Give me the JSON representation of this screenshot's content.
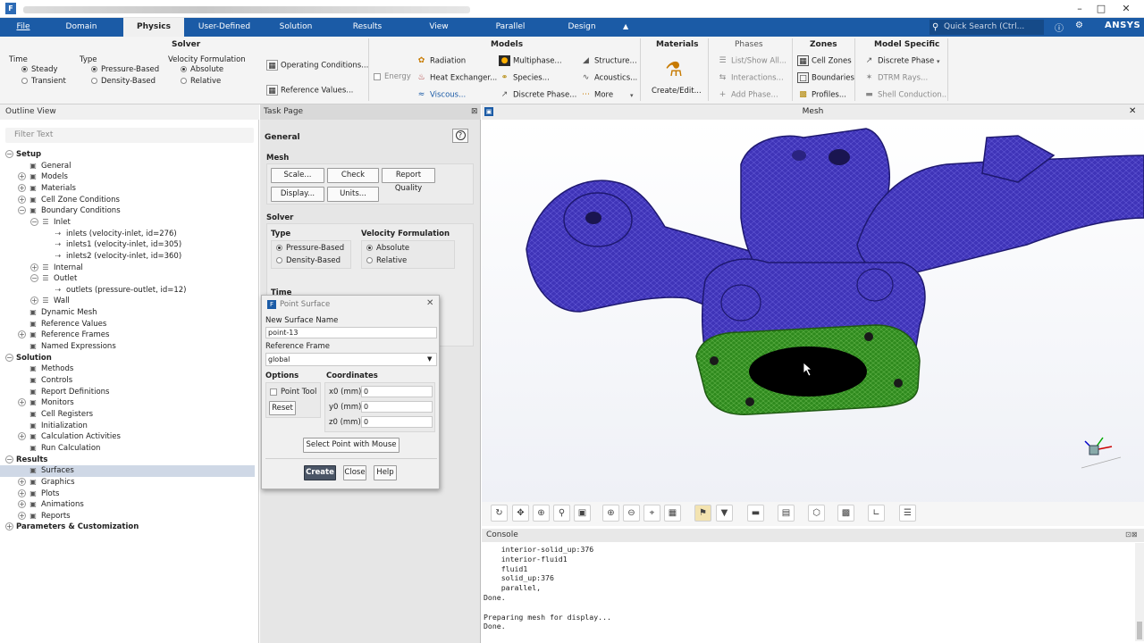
{
  "window": {
    "logo": "F",
    "controls": [
      "–",
      "□",
      "✕"
    ]
  },
  "menu": {
    "items": [
      "File",
      "Domain",
      "Physics",
      "User-Defined",
      "Solution",
      "Results",
      "View",
      "Parallel",
      "Design"
    ],
    "active": "Physics",
    "search_placeholder": "Quick Search (Ctrl...",
    "brand": "ANSYS",
    "caret": "▲"
  },
  "ribbon": {
    "solver": {
      "title": "Solver",
      "time_label": "Time",
      "time_options": [
        "Steady",
        "Transient"
      ],
      "type_label": "Type",
      "type_options": [
        "Pressure-Based",
        "Density-Based"
      ],
      "velocity_label": "Velocity Formulation",
      "velocity_options": [
        "Absolute",
        "Relative"
      ],
      "operating": "Operating Conditions...",
      "reference": "Reference Values..."
    },
    "models": {
      "title": "Models",
      "energy": "Energy",
      "items": [
        "Radiation",
        "Heat Exchanger...",
        "Viscous...",
        "Multiphase...",
        "Species...",
        "Discrete Phase...",
        "Structure...",
        "Acoustics...",
        "More"
      ]
    },
    "materials": {
      "title": "Materials",
      "create": "Create/Edit..."
    },
    "phases": {
      "title": "Phases",
      "items": [
        "List/Show All...",
        "Interactions...",
        "Add Phase..."
      ]
    },
    "zones": {
      "title": "Zones",
      "items": [
        "Cell Zones",
        "Boundaries",
        "Profiles..."
      ]
    },
    "model_specific": {
      "title": "Model Specific",
      "items": [
        "Discrete Phase",
        "DTRM Rays...",
        "Shell Conduction..."
      ]
    }
  },
  "outline": {
    "title": "Outline View",
    "filter_placeholder": "Filter Text",
    "rows": [
      {
        "label": "Setup",
        "bold": true,
        "indent": 0,
        "toggle": "⊖"
      },
      {
        "label": "General",
        "indent": 1
      },
      {
        "label": "Models",
        "indent": 1,
        "toggle": "⊕"
      },
      {
        "label": "Materials",
        "indent": 1,
        "toggle": "⊕"
      },
      {
        "label": "Cell Zone Conditions",
        "indent": 1,
        "toggle": "⊕"
      },
      {
        "label": "Boundary Conditions",
        "indent": 1,
        "toggle": "⊖"
      },
      {
        "label": "Inlet",
        "indent": 2,
        "toggle": "⊖"
      },
      {
        "label": "inlets (velocity-inlet, id=276)",
        "indent": 3
      },
      {
        "label": "inlets1 (velocity-inlet, id=305)",
        "indent": 3
      },
      {
        "label": "inlets2 (velocity-inlet, id=360)",
        "indent": 3
      },
      {
        "label": "Internal",
        "indent": 2,
        "toggle": "⊕"
      },
      {
        "label": "Outlet",
        "indent": 2,
        "toggle": "⊖"
      },
      {
        "label": "outlets (pressure-outlet, id=12)",
        "indent": 3
      },
      {
        "label": "Wall",
        "indent": 2,
        "toggle": "⊕"
      },
      {
        "label": "Dynamic Mesh",
        "indent": 1
      },
      {
        "label": "Reference Values",
        "indent": 1
      },
      {
        "label": "Reference Frames",
        "indent": 1,
        "toggle": "⊕"
      },
      {
        "label": "Named Expressions",
        "indent": 1
      },
      {
        "label": "Solution",
        "bold": true,
        "indent": 0,
        "toggle": "⊖"
      },
      {
        "label": "Methods",
        "indent": 1
      },
      {
        "label": "Controls",
        "indent": 1
      },
      {
        "label": "Report Definitions",
        "indent": 1
      },
      {
        "label": "Monitors",
        "indent": 1,
        "toggle": "⊕"
      },
      {
        "label": "Cell Registers",
        "indent": 1
      },
      {
        "label": "Initialization",
        "indent": 1
      },
      {
        "label": "Calculation Activities",
        "indent": 1,
        "toggle": "⊕"
      },
      {
        "label": "Run Calculation",
        "indent": 1
      },
      {
        "label": "Results",
        "bold": true,
        "indent": 0,
        "toggle": "⊖"
      },
      {
        "label": "Surfaces",
        "indent": 1,
        "selected": true
      },
      {
        "label": "Graphics",
        "indent": 1,
        "toggle": "⊕"
      },
      {
        "label": "Plots",
        "indent": 1,
        "toggle": "⊕"
      },
      {
        "label": "Animations",
        "indent": 1,
        "toggle": "⊕"
      },
      {
        "label": "Reports",
        "indent": 1,
        "toggle": "⊕"
      },
      {
        "label": "Parameters & Customization",
        "bold": true,
        "indent": 0,
        "toggle": "⊕"
      }
    ]
  },
  "task": {
    "title": "Task Page",
    "page": "General",
    "help": "?",
    "mesh_label": "Mesh",
    "buttons": [
      "Scale...",
      "Check",
      "Report Quality",
      "Display...",
      "Units..."
    ],
    "solver_label": "Solver",
    "type_label": "Type",
    "type_options": [
      "Pressure-Based",
      "Density-Based"
    ],
    "velocity_label": "Velocity Formulation",
    "velocity_options": [
      "Absolute",
      "Relative"
    ],
    "time_label": "Time"
  },
  "dialog": {
    "title": "Point Surface",
    "name_label": "New Surface Name",
    "name_value": "point-13",
    "frame_label": "Reference Frame",
    "frame_value": "global",
    "options_label": "Options",
    "point_tool": "Point Tool",
    "reset": "Reset",
    "coords_label": "Coordinates",
    "coords": [
      {
        "label": "x0 (mm)",
        "value": "0"
      },
      {
        "label": "y0 (mm)",
        "value": "0"
      },
      {
        "label": "z0 (mm)",
        "value": "0"
      }
    ],
    "select_point": "Select Point with Mouse",
    "create": "Create",
    "close": "Close",
    "help": "Help"
  },
  "graphics": {
    "title": "Mesh",
    "close": "✕"
  },
  "console": {
    "title": "Console",
    "text": "    interior-solid_up:376\n    interior-fluid1\n    fluid1\n    solid_up:376\n    parallel,\nDone.\n\nPreparing mesh for display...\nDone."
  },
  "colors": {
    "menubar": "#1b5ba6",
    "mesh_blue": "#3f34b8",
    "mesh_green": "#2f8a1e",
    "selected": "#cfd8e6"
  }
}
